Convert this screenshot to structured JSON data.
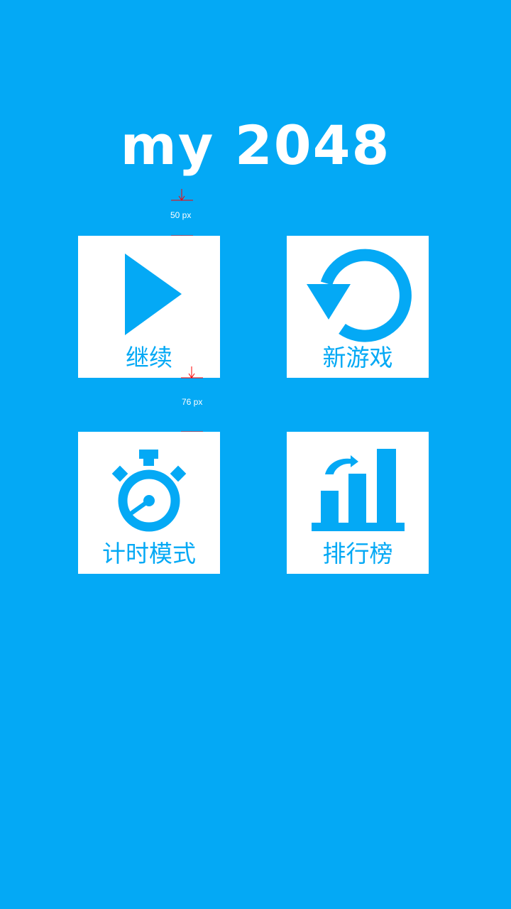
{
  "title": "my 2048",
  "colors": {
    "background": "#04a9f5",
    "tile": "#ffffff",
    "accent": "#04a9f5",
    "measure_line": "#ff0000"
  },
  "tiles": [
    {
      "id": "continue",
      "label": "继续",
      "icon": "play-icon"
    },
    {
      "id": "new_game",
      "label": "新游戏",
      "icon": "restart-icon"
    },
    {
      "id": "timed_mode",
      "label": "计时模式",
      "icon": "stopwatch-icon"
    },
    {
      "id": "leaderboard",
      "label": "排行榜",
      "icon": "bar-chart-icon"
    }
  ],
  "annotations": {
    "gap_top": "50 px",
    "gap_middle": "76 px"
  }
}
